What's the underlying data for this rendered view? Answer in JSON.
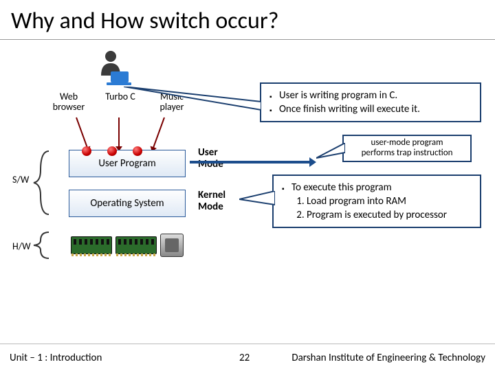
{
  "title": "Why and How switch occur?",
  "apps": {
    "web": "Web browser",
    "turbo": "Turbo C",
    "music": "Music player"
  },
  "boxes": {
    "user_program": "User Program",
    "os": "Operating System"
  },
  "side": {
    "sw": "S/W",
    "hw": "H/W"
  },
  "modes": {
    "user": "User Mode",
    "kernel": "Kernel Mode"
  },
  "callouts": {
    "c1_a": "User is writing program in C.",
    "c1_b": "Once finish writing will execute it.",
    "c2_line1": "user-mode program",
    "c2_line2": "performs trap instruction",
    "c3_head": "To execute this program",
    "c3_1": "Load program into RAM",
    "c3_2": "Program is executed by processor"
  },
  "footer": {
    "unit": "Unit – 1 : Introduction",
    "page": "22",
    "institute": "Darshan Institute of Engineering & Technology"
  }
}
